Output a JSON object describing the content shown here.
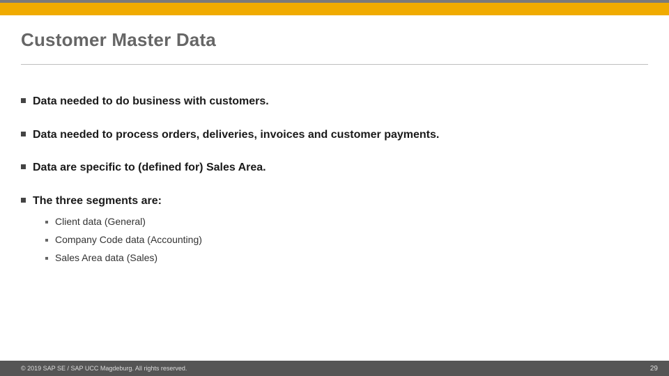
{
  "colors": {
    "accent": "#f0ab00",
    "topThin": "#7a7a7a",
    "footerBg": "#555555"
  },
  "title": "Customer Master Data",
  "bullets": {
    "b0": "Data needed to do business with customers.",
    "b1": "Data needed to process orders, deliveries, invoices and customer payments.",
    "b2": "Data are specific to (defined for) Sales Area.",
    "b3": "The three segments are:"
  },
  "subitems": {
    "s0": "Client data  (General)",
    "s1": "Company Code data (Accounting)",
    "s2": "Sales Area data (Sales)"
  },
  "footer": {
    "copyright": "© 2019 SAP SE / SAP UCC Magdeburg. All rights reserved.",
    "page": "29"
  }
}
